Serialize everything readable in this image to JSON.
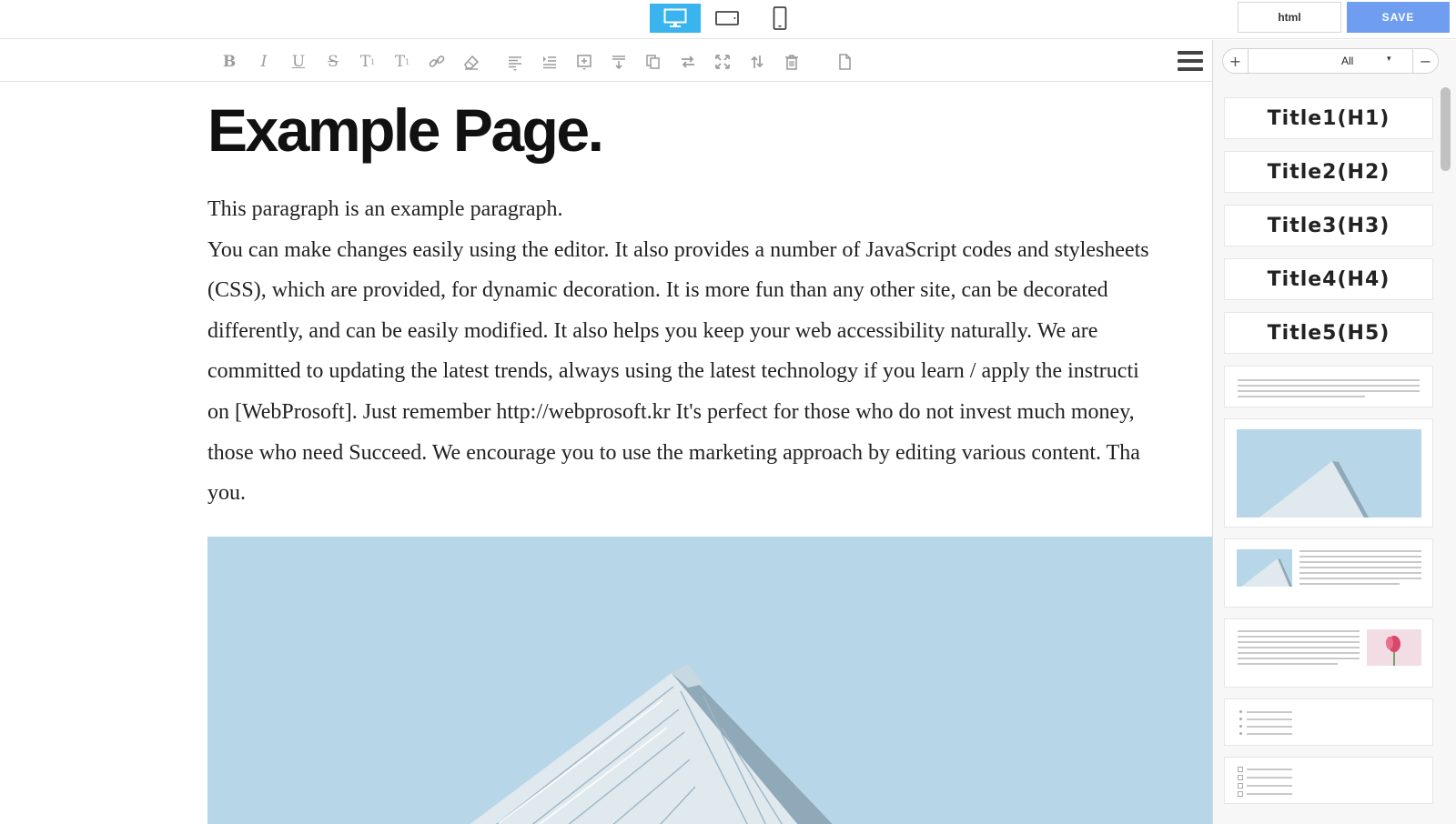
{
  "header": {
    "devices": [
      {
        "name": "desktop",
        "icon": "desktop-monitor-icon",
        "active": true
      },
      {
        "name": "tablet",
        "icon": "tablet-landscape-icon",
        "active": false
      },
      {
        "name": "mobile",
        "icon": "mobile-phone-icon",
        "active": false
      }
    ],
    "html_label": "html",
    "save_label": "SAVE",
    "accent_color": "#3ab4ee",
    "save_color": "#6f9ef0"
  },
  "toolbar": {
    "bold": "B",
    "italic": "I",
    "underline": "U",
    "strike": "S",
    "superscript": "T",
    "superscript_mark": "1",
    "subscript": "T",
    "subscript_mark": "1",
    "icons": [
      "bold-icon",
      "italic-icon",
      "underline-icon",
      "strikethrough-icon",
      "superscript-icon",
      "subscript-icon",
      "link-icon",
      "eraser-icon",
      "align-icon",
      "indent-icon",
      "insert-block-icon",
      "insert-row-icon",
      "copy-icon",
      "swap-icon",
      "fullscreen-icon",
      "move-icon",
      "trash-icon",
      "page-icon",
      "menu-icon"
    ]
  },
  "page": {
    "title": "Example Page.",
    "paragraph_lines": [
      "This paragraph is an example paragraph.",
      "You can make changes easily using the editor. It also provides a number of JavaScript codes and stylesheets",
      "(CSS), which are provided, for dynamic decoration. It is more fun than any other site, can be decorated",
      "differently, and can be easily modified. It also helps you keep your web accessibility naturally. We are",
      "committed to updating the latest trends, always using the latest technology if you learn / apply the instructi",
      "on [WebProsoft]. Just remember http://webprosoft.kr It's perfect for those who do not invest much money,",
      "those who need Succeed. We encourage you to use the marketing approach by editing various content. Tha",
      "you."
    ]
  },
  "panel": {
    "filter_plus": "+",
    "filter_value": "All",
    "filter_caret": "▾",
    "filter_minus": "−",
    "titles": [
      "Title1(H1)",
      "Title2(H2)",
      "Title3(H3)",
      "Title4(H4)",
      "Title5(H5)"
    ]
  }
}
